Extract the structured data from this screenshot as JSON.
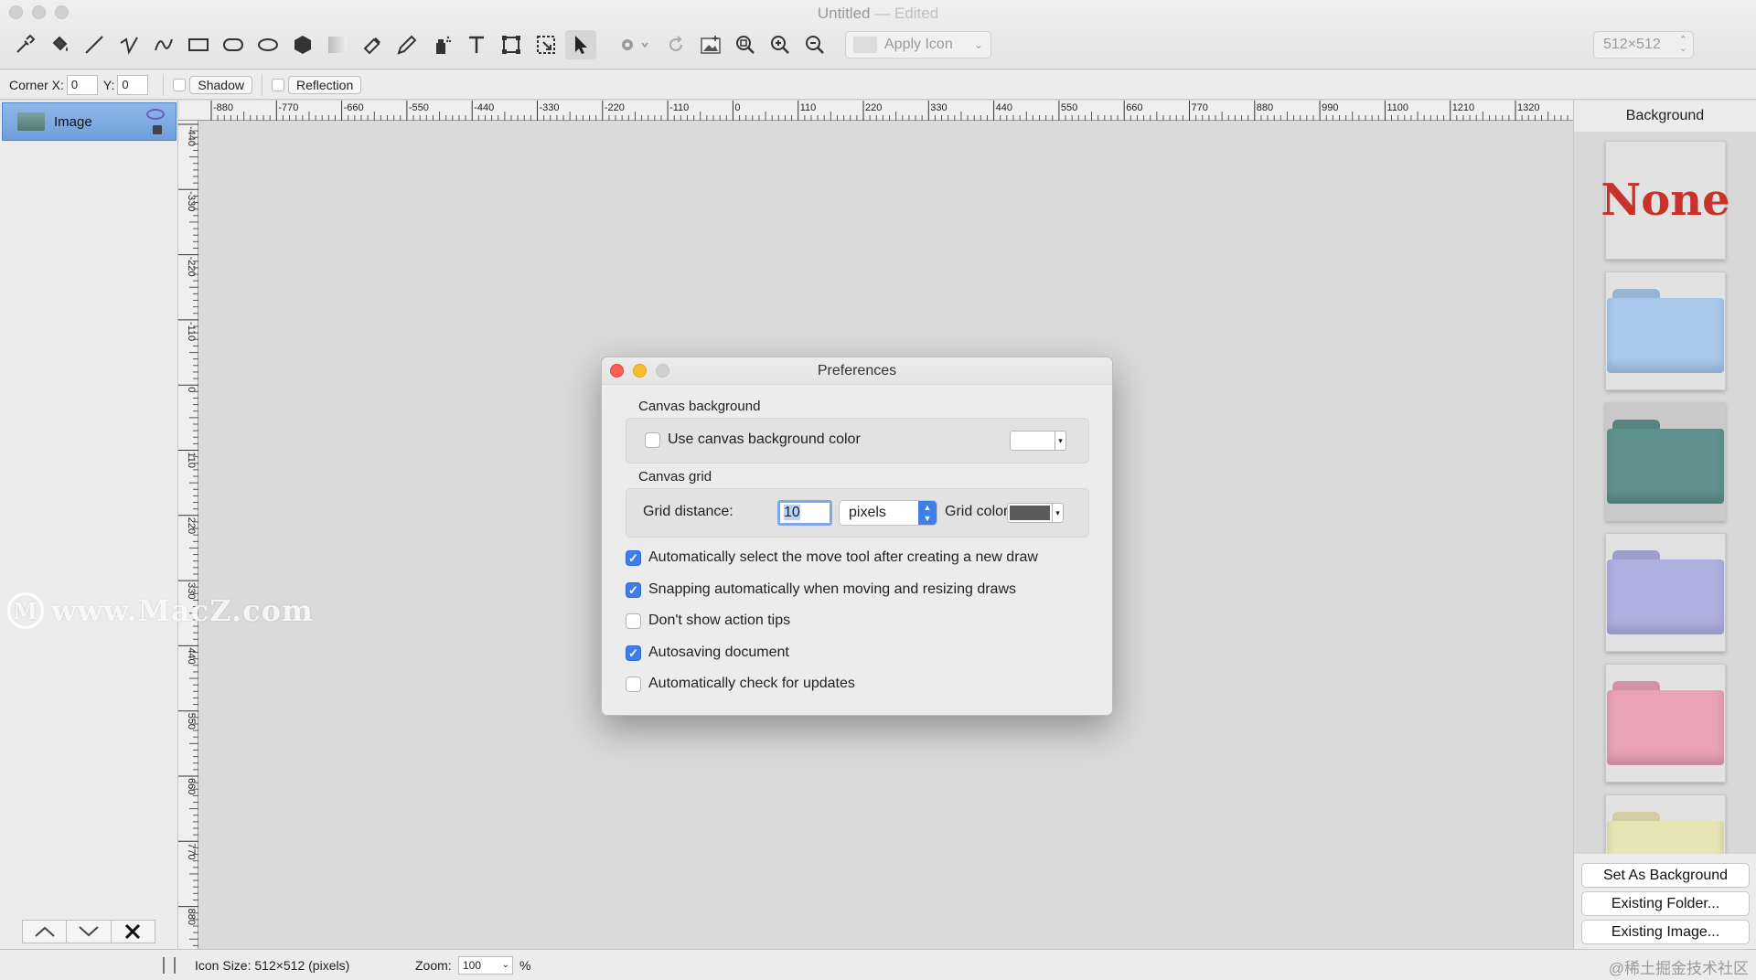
{
  "window": {
    "title": "Untitled",
    "edited": "— Edited"
  },
  "toolbar": {
    "tools": [
      "eyedropper-icon",
      "paint-bucket-icon",
      "line-icon",
      "polyline-icon",
      "curve-icon",
      "rectangle-icon",
      "rounded-rectangle-icon",
      "ellipse-icon",
      "polygon-icon",
      "gradient-icon",
      "eraser-icon",
      "pencil-icon",
      "spray-icon",
      "text-icon",
      "transform-icon",
      "crop-icon",
      "pointer-icon"
    ],
    "apply_icon_label": "Apply Icon",
    "size_value": "512×512"
  },
  "options": {
    "corner_x_label": "Corner X:",
    "corner_x": "0",
    "y_label": "Y:",
    "y": "0",
    "shadow_label": "Shadow",
    "reflection_label": "Reflection"
  },
  "layers": {
    "items": [
      {
        "name": "Image",
        "selected": true
      }
    ]
  },
  "ruler": {
    "h_labels": [
      "-880",
      "-770",
      "-660",
      "-550",
      "-440",
      "-330",
      "-220",
      "-110",
      "0",
      "110",
      "220",
      "330",
      "440",
      "550",
      "660",
      "770",
      "880",
      "990",
      "1100",
      "1210",
      "1320"
    ],
    "v_labels": [
      "-440",
      "-330",
      "-220",
      "-110",
      "0",
      "110",
      "220",
      "330",
      "440",
      "550",
      "660",
      "770",
      "880"
    ]
  },
  "watermark": {
    "text": "www.MacZ.com"
  },
  "background_panel": {
    "title": "Background",
    "none_label": "None",
    "folders": [
      {
        "name": "blue",
        "color": "#a9c9ec"
      },
      {
        "name": "teal",
        "color": "#5f928e"
      },
      {
        "name": "lavender",
        "color": "#aeb1e0"
      },
      {
        "name": "pink",
        "color": "#eaa2b6"
      },
      {
        "name": "yellow",
        "color": "#e9e4b4"
      }
    ],
    "buttons": {
      "set_as_background": "Set As Background",
      "existing_folder": "Existing Folder...",
      "existing_image": "Existing Image..."
    }
  },
  "status": {
    "icon_size": "Icon Size: 512×512 (pixels)",
    "zoom_label": "Zoom:",
    "zoom_value": "100",
    "percent": "%",
    "credit": "@稀土掘金技术社区"
  },
  "preferences": {
    "title": "Preferences",
    "canvas_background_label": "Canvas background",
    "use_canvas_bg_label": "Use canvas background color",
    "use_canvas_bg_checked": false,
    "canvas_bg_color": "#ffffff",
    "canvas_grid_label": "Canvas grid",
    "grid_distance_label": "Grid distance:",
    "grid_distance_value": "10",
    "grid_unit": "pixels",
    "grid_color_label": "Grid color:",
    "grid_color": "#5b5b5b",
    "options": [
      {
        "label": "Automatically select the move tool after creating a new draw",
        "checked": true
      },
      {
        "label": "Snapping automatically when moving and resizing draws",
        "checked": true
      },
      {
        "label": "Don't show action tips",
        "checked": false
      },
      {
        "label": "Autosaving document",
        "checked": true
      },
      {
        "label": "Automatically check for updates",
        "checked": false
      }
    ]
  }
}
